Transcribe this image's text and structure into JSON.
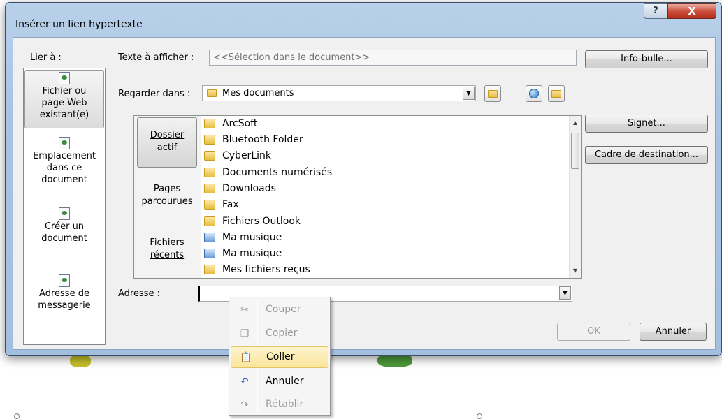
{
  "window": {
    "title": "Insérer un lien hypertexte",
    "help_label": "?",
    "close_label": "X"
  },
  "link_to": {
    "label": "Lier à :",
    "items": [
      {
        "line1": "Fichier ou",
        "line2": "page Web",
        "line3": "existant(e)"
      },
      {
        "line1": "Emplacement",
        "line2": "dans ce",
        "line3": "document"
      },
      {
        "line1": "Créer un",
        "line2": "document"
      },
      {
        "line1": "Adresse de",
        "line2": "messagerie"
      }
    ]
  },
  "text_to_display": {
    "label": "Texte à afficher :",
    "value": "<<Sélection dans le document>>"
  },
  "buttons": {
    "screentip": "Info-bulle...",
    "bookmark": "Signet...",
    "target_frame": "Cadre de destination...",
    "ok": "OK",
    "cancel": "Annuler"
  },
  "look_in": {
    "label": "Regarder dans :",
    "value": "Mes documents"
  },
  "nav": {
    "current_folder": {
      "line1": "Dossier",
      "line2": "actif"
    },
    "browsed_pages": {
      "line1": "Pages",
      "line2": "parcourues"
    },
    "recent_files": {
      "line1": "Fichiers",
      "line2": "récents"
    }
  },
  "files": [
    {
      "name": "ArcSoft",
      "icon": "folder-icon"
    },
    {
      "name": "Bluetooth Folder",
      "icon": "folder-icon"
    },
    {
      "name": "CyberLink",
      "icon": "folder-icon"
    },
    {
      "name": "Documents numérisés",
      "icon": "folder-icon"
    },
    {
      "name": "Downloads",
      "icon": "folder-icon"
    },
    {
      "name": "Fax",
      "icon": "folder-icon"
    },
    {
      "name": "Fichiers Outlook",
      "icon": "folder-icon"
    },
    {
      "name": "Ma musique",
      "icon": "music-folder-icon"
    },
    {
      "name": "Ma musique",
      "icon": "music-folder-icon"
    },
    {
      "name": "Mes fichiers reçus",
      "icon": "folder-icon"
    }
  ],
  "address": {
    "label": "Adresse :",
    "value": ""
  },
  "context_menu": [
    {
      "label": "Couper",
      "icon": "scissors-icon",
      "enabled": false
    },
    {
      "label": "Copier",
      "icon": "copy-icon",
      "enabled": false
    },
    {
      "label": "Coller",
      "icon": "paste-icon",
      "enabled": true,
      "highlighted": true
    },
    {
      "label": "Annuler",
      "icon": "undo-icon",
      "enabled": true
    },
    {
      "label": "Rétablir",
      "icon": "redo-icon",
      "enabled": false
    }
  ],
  "colors": {
    "window_frame": "#a9c4e2",
    "close_button": "#c94a36",
    "highlight": "#fbe59a"
  }
}
